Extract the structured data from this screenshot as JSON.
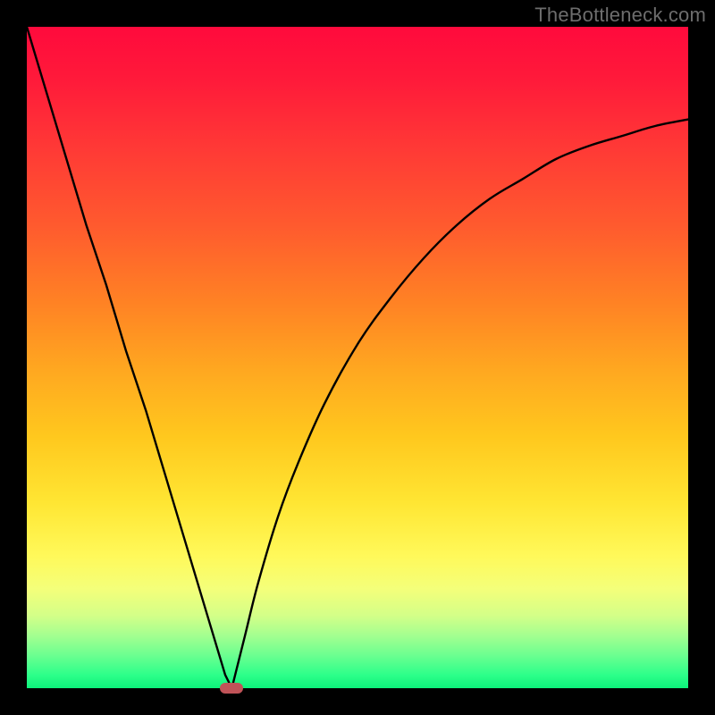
{
  "watermark": "TheBottleneck.com",
  "colors": {
    "frame": "#000000",
    "curve": "#000000",
    "marker": "#c05358"
  },
  "chart_data": {
    "type": "line",
    "title": "",
    "xlabel": "",
    "ylabel": "",
    "xlim": [
      0,
      100
    ],
    "ylim": [
      0,
      100
    ],
    "grid": false,
    "notes": "Bottleneck-style V curve. Y is percentage (100 at top). Minimum ~0 at x≈31. Left branch rises steeply to ~100 at x=0. Right branch asymptotically approaches ~86 at x=100.",
    "series": [
      {
        "name": "left",
        "x": [
          0,
          3,
          6,
          9,
          12,
          15,
          18,
          21,
          24,
          27,
          30,
          31
        ],
        "values": [
          100,
          90,
          80,
          70,
          61,
          51,
          42,
          32,
          22,
          12,
          2,
          0
        ]
      },
      {
        "name": "right",
        "x": [
          31,
          33,
          35,
          38,
          41,
          45,
          50,
          55,
          60,
          65,
          70,
          75,
          80,
          85,
          90,
          95,
          100
        ],
        "values": [
          0,
          8,
          16,
          26,
          34,
          43,
          52,
          59,
          65,
          70,
          74,
          77,
          80,
          82,
          83.5,
          85,
          86
        ]
      }
    ],
    "marker": {
      "x": 31,
      "y": 0,
      "shape": "pill"
    }
  }
}
